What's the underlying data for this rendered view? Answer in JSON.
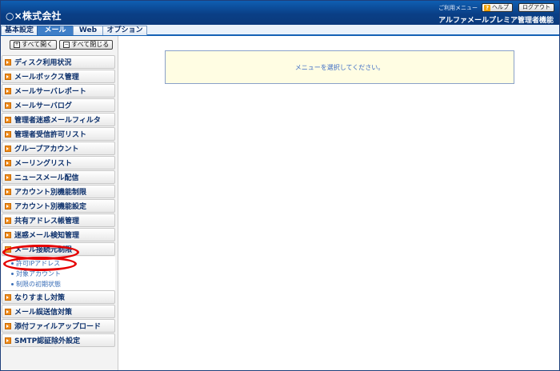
{
  "header": {
    "company": "○×株式会社",
    "help_label": "ご利用メニュー",
    "help_button": "ヘルプ",
    "help_icon_glyph": "?",
    "logout_button": "ログアウト",
    "product_name": "アルファメールプレミア管理者機能"
  },
  "tabs": [
    {
      "label": "基本設定",
      "active": false
    },
    {
      "label": "メール",
      "active": true
    },
    {
      "label": "Web",
      "active": false
    },
    {
      "label": "オプション",
      "active": false
    }
  ],
  "sidebar": {
    "expand_all": "すべて開く",
    "collapse_all": "すべて閉じる",
    "expand_glyph": "+",
    "collapse_glyph": "−",
    "items": [
      "ディスク利用状況",
      "メールボックス管理",
      "メールサーバレポート",
      "メールサーバログ",
      "管理者迷惑メールフィルタ",
      "管理者受信許可リスト",
      "グループアカウント",
      "メーリングリスト",
      "ニュースメール配信",
      "アカウント別機能制限",
      "アカウント別機能設定",
      "共有アドレス帳管理",
      "迷惑メール検知管理",
      "メール接続元制限",
      "なりすまし対策",
      "メール誤送信対策",
      "添付ファイルアップロード",
      "SMTP認証除外設定"
    ],
    "sub_items": [
      "許可IPアドレス",
      "対象アカウント",
      "制限の初期状態"
    ]
  },
  "main": {
    "message": "メニューを選択してください。"
  },
  "colors": {
    "header_blue": "#0a3f86",
    "menu_bullet": "#ef8b1a",
    "highlight_oval": "#e60000",
    "message_bg": "#fffde3"
  }
}
